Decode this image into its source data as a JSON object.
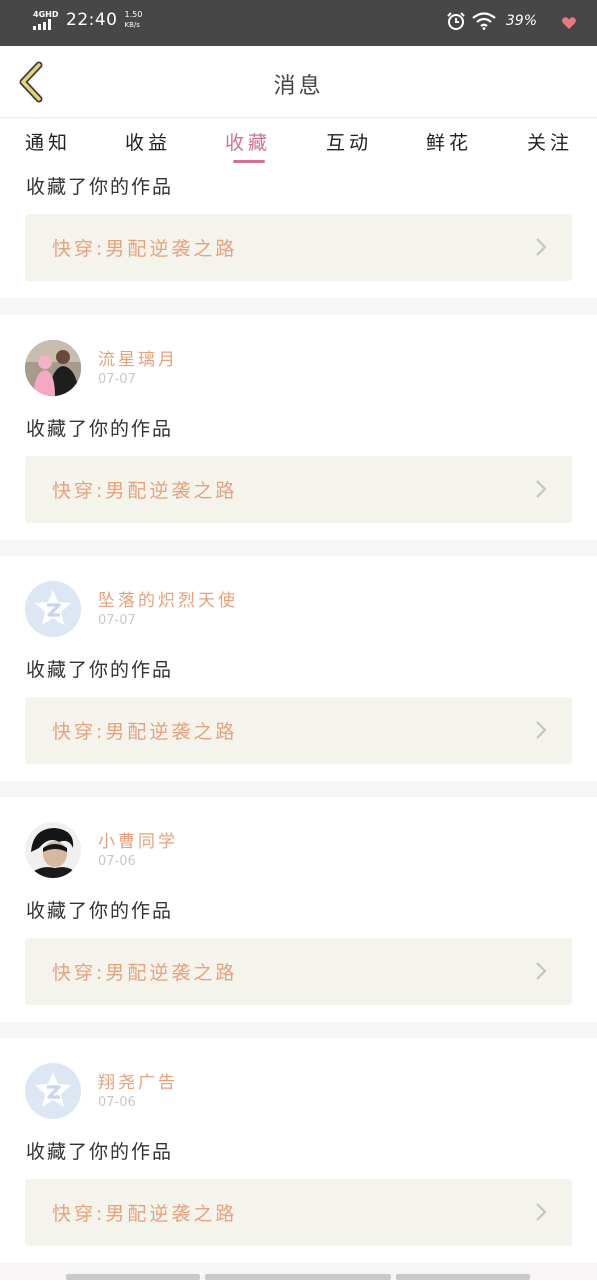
{
  "status_bar": {
    "network": "4GHD",
    "time": "22:40",
    "speed_value": "1.50",
    "speed_unit": "KB/s",
    "battery": "39%"
  },
  "header": {
    "title": "消息"
  },
  "tabs": [
    {
      "label": "通知"
    },
    {
      "label": "收益"
    },
    {
      "label": "收藏",
      "active": true
    },
    {
      "label": "互动"
    },
    {
      "label": "鲜花"
    },
    {
      "label": "关注"
    }
  ],
  "partial_card": {
    "action": "收藏了你的作品",
    "work": "快穿:男配逆袭之路"
  },
  "items": [
    {
      "user": "流星璃月",
      "date": "07-07",
      "action": "收藏了你的作品",
      "work": "快穿:男配逆袭之路",
      "avatar": "photo-avatar"
    },
    {
      "user": "坠落的炽烈天使",
      "date": "07-07",
      "action": "收藏了你的作品",
      "work": "快穿:男配逆袭之路",
      "avatar": "default-avatar"
    },
    {
      "user": "小曹同学",
      "date": "07-06",
      "action": "收藏了你的作品",
      "work": "快穿:男配逆袭之路",
      "avatar": "photo-avatar"
    },
    {
      "user": "翔尧广告",
      "date": "07-06",
      "action": "收藏了你的作品",
      "work": "快穿:男配逆袭之路",
      "avatar": "default-avatar"
    }
  ],
  "colors": {
    "accent": "#d36f93",
    "username": "#e6a07c",
    "work_link_bg": "#f4f4ec"
  }
}
